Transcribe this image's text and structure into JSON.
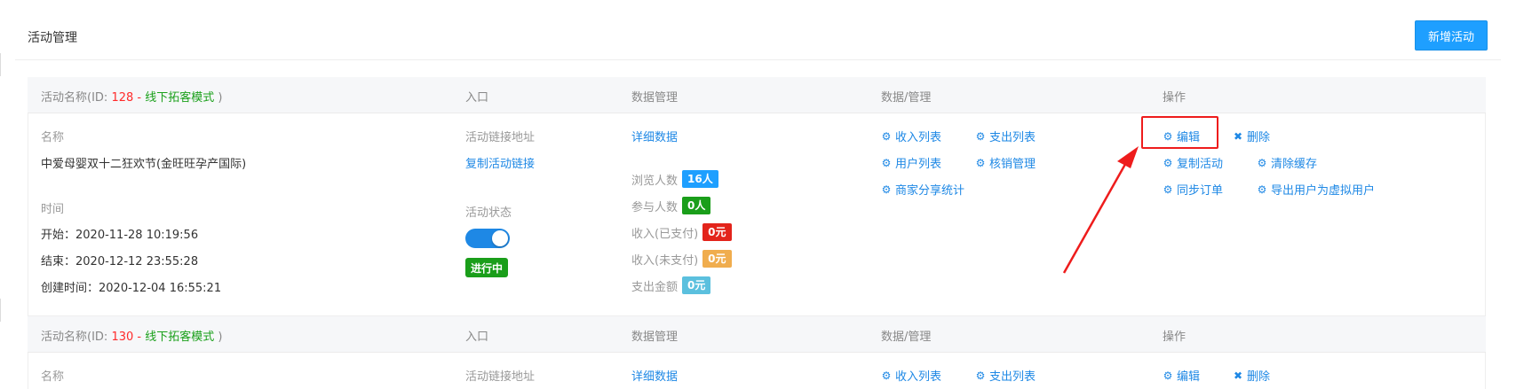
{
  "page": {
    "title": "活动管理",
    "add_button": "新增活动"
  },
  "columns": {
    "name_prefix": "活动名称(ID: ",
    "mode_sep": " - ",
    "suffix": " )",
    "entry": "入口",
    "data_mgmt": "数据管理",
    "data_slash_mgmt": "数据/管理",
    "ops": "操作"
  },
  "labels": {
    "name": "名称",
    "time": "时间",
    "link_addr": "活动链接地址",
    "copy_link": "复制活动链接",
    "status": "活动状态",
    "detail_data": "详细数据",
    "start": "开始：",
    "end": "结束：",
    "created": "创建时间："
  },
  "stats_labels": [
    "浏览人数",
    "参与人数",
    "收入(已支付)",
    "收入(未支付)",
    "支出金额"
  ],
  "data_links": [
    "收入列表",
    "支出列表",
    "用户列表",
    "核销管理",
    "商家分享统计"
  ],
  "ops_links": [
    "编辑",
    "删除",
    "复制活动",
    "清除缓存",
    "同步订单",
    "导出用户为虚拟用户"
  ],
  "icons": {
    "gear": "gear-icon",
    "close": "close-icon"
  },
  "colors": {
    "primary": "#1e9fff",
    "link": "#1e88e5",
    "id_red": "#ff2a2a",
    "mode_green": "#1aa01a",
    "badge_views": "#1e9fff",
    "badge_join": "#1a9e1a",
    "badge_paid": "#e3241b",
    "badge_unpaid": "#f0ad4e",
    "badge_expense": "#5bc0de",
    "annotation": "#ee1c1c"
  },
  "activities": [
    {
      "id": "128",
      "mode": "线下拓客模式",
      "name": "中爱母婴双十二狂欢节(金旺旺孕产国际)",
      "start": "2020-11-28 10:19:56",
      "end": "2020-12-12 23:55:28",
      "created": "2020-12-04 16:55:21",
      "status_label": "进行中",
      "enabled": true,
      "stats": [
        "16人",
        "0人",
        "0元",
        "0元",
        "0元"
      ]
    },
    {
      "id": "130",
      "mode": "线下拓客模式"
    }
  ]
}
